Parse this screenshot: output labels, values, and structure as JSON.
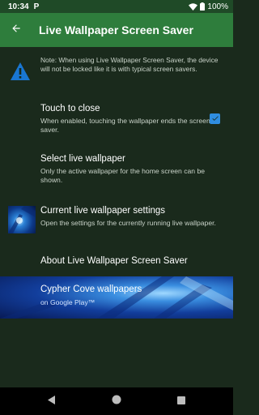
{
  "status_bar": {
    "time": "10:34",
    "notification_icon": "P",
    "battery": "100%"
  },
  "app_bar": {
    "title": "Live Wallpaper Screen Saver",
    "background_color": "#2e7d3c"
  },
  "note": {
    "text": "Note: When using Live Wallpaper Screen Saver, the device will not be locked like it is with typical screen savers.",
    "icon": "warning-icon",
    "icon_color": "#1976d2"
  },
  "settings": [
    {
      "title": "Touch to close",
      "subtitle": "When enabled, touching the wallpaper ends the screen saver.",
      "checked": true
    },
    {
      "title": "Select live wallpaper",
      "subtitle": "Only the active wallpaper for the home screen can be shown."
    },
    {
      "title": "Current live wallpaper settings",
      "subtitle": "Open the settings for the currently running live wallpaper."
    },
    {
      "title": "About Live Wallpaper Screen Saver",
      "subtitle": ""
    }
  ],
  "banner": {
    "title": "Cypher Cove wallpapers",
    "subtitle": "on Google Play™"
  },
  "nav_bar": {
    "back": "back-triangle-icon",
    "home": "home-circle-icon",
    "recents": "recents-square-icon"
  }
}
